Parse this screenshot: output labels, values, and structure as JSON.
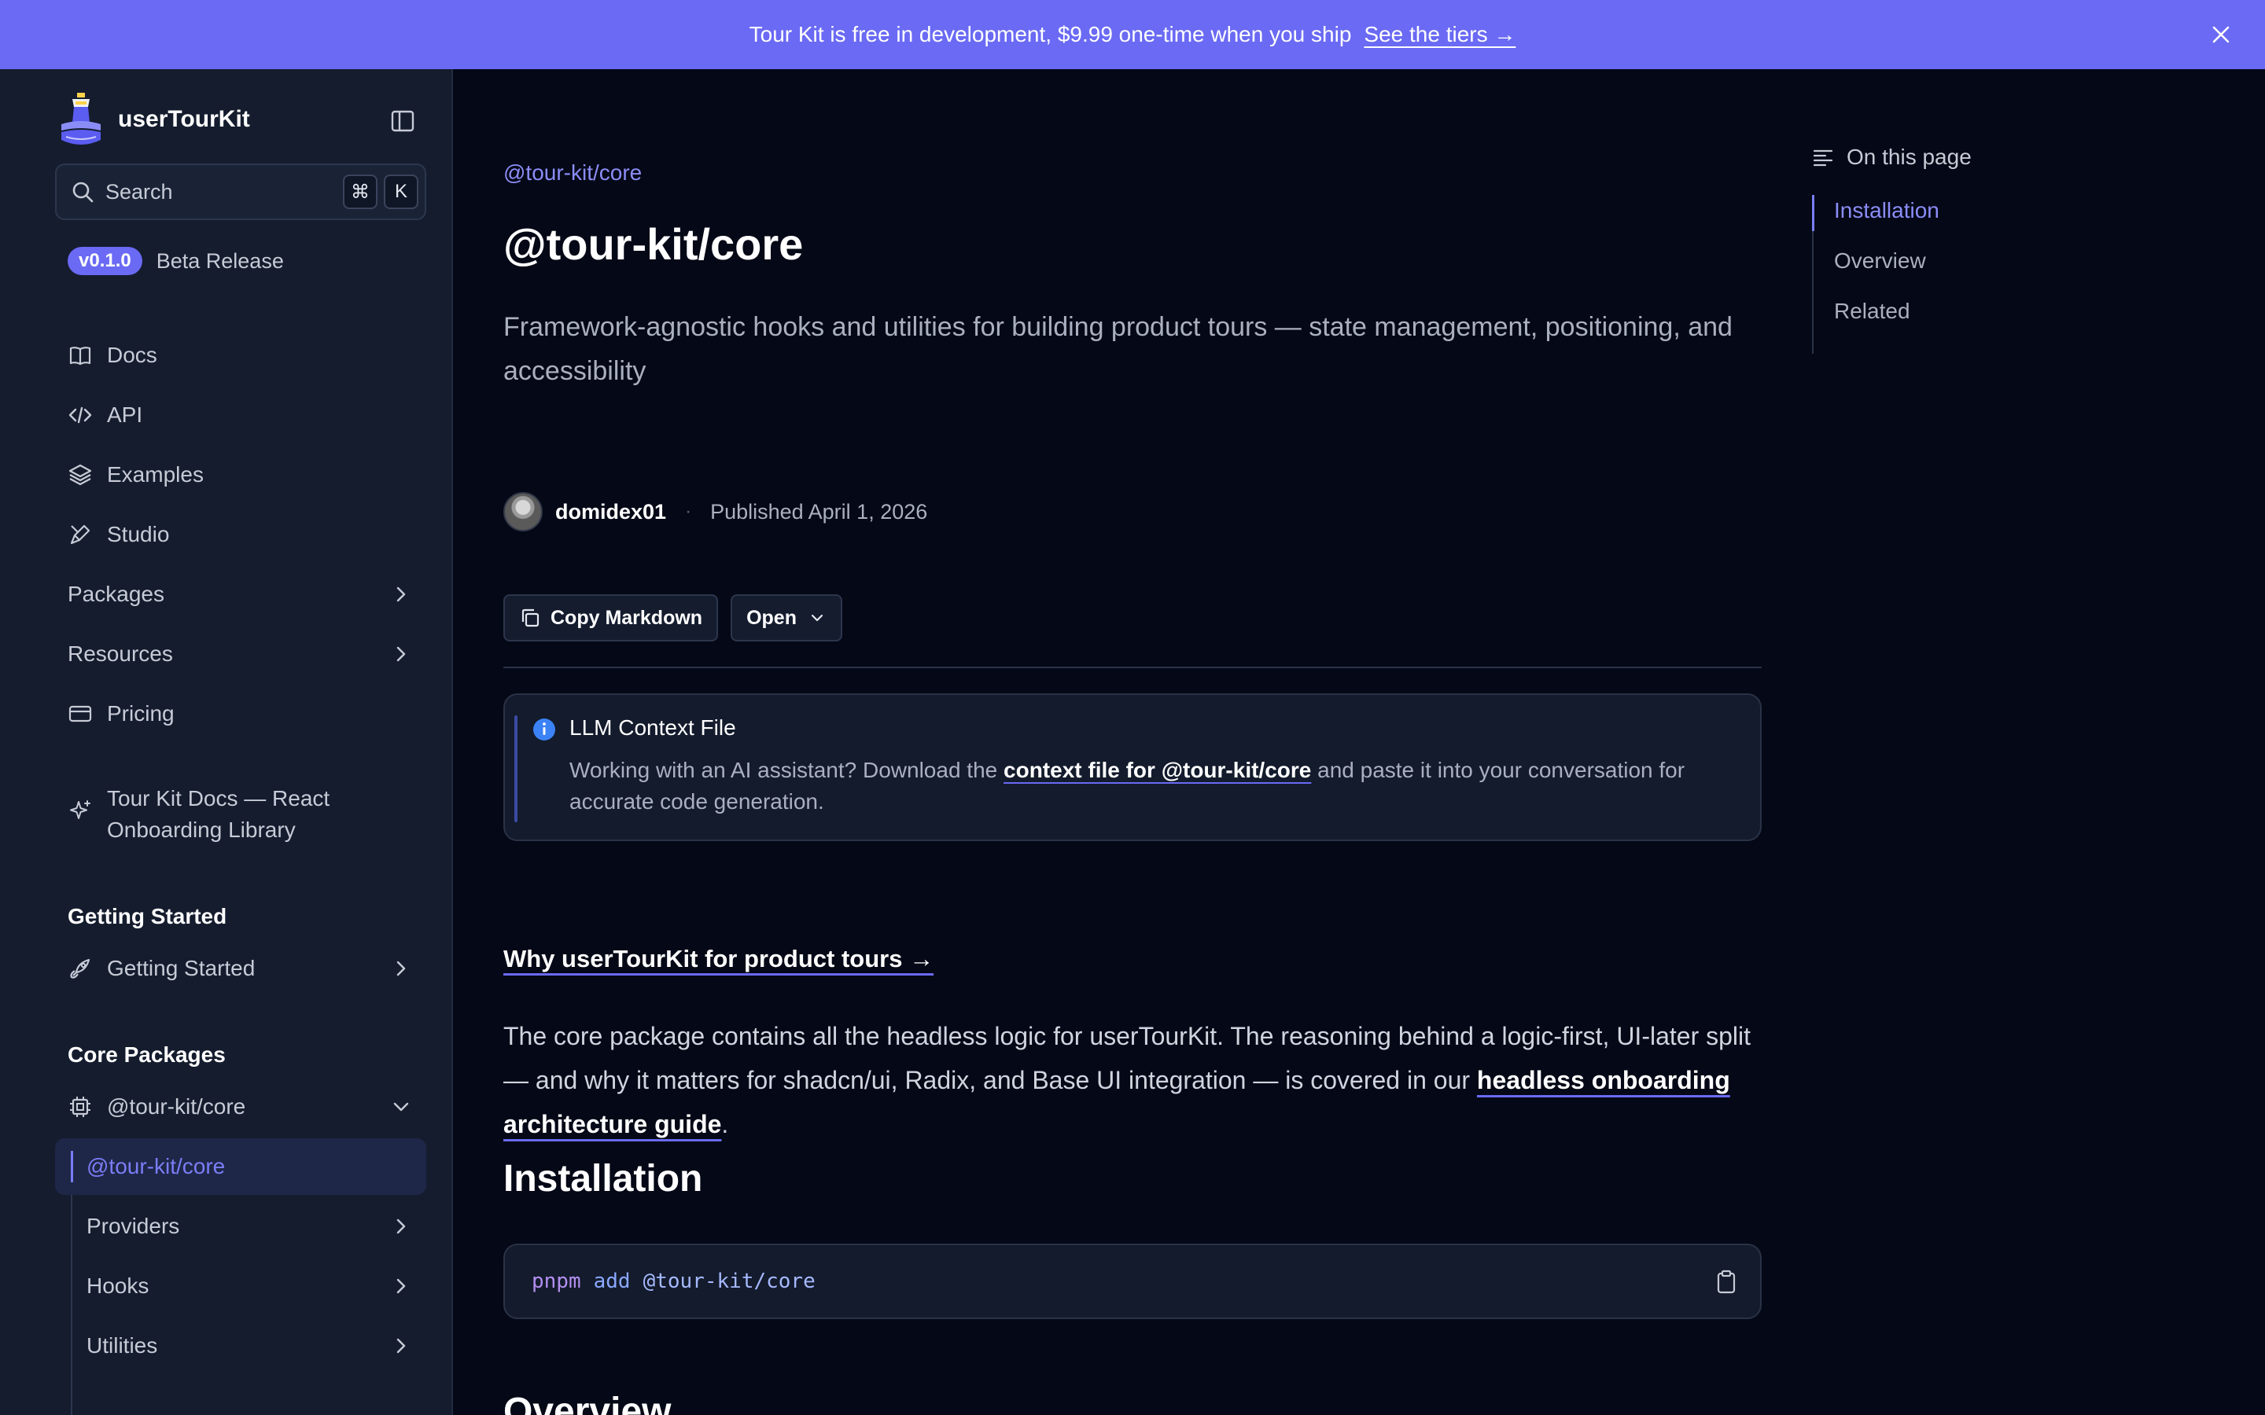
{
  "banner": {
    "message": "Tour Kit is free in development, $9.99 one-time when you ship",
    "cta": "See the tiers →"
  },
  "sidebar": {
    "brand": "userTourKit",
    "search": {
      "placeholder": "Search",
      "shortcut_mod": "⌘",
      "shortcut_key": "K"
    },
    "version": {
      "tag": "v0.1.0",
      "label": "Beta Release"
    },
    "nav": [
      {
        "label": "Docs",
        "icon": "book-icon"
      },
      {
        "label": "API",
        "icon": "code-icon"
      },
      {
        "label": "Examples",
        "icon": "layers-icon"
      },
      {
        "label": "Studio",
        "icon": "pen-tool-icon"
      },
      {
        "label": "Packages",
        "icon": "chevron-right-icon"
      },
      {
        "label": "Resources",
        "icon": "chevron-right-icon"
      },
      {
        "label": "Pricing",
        "icon": "credit-card-icon"
      }
    ],
    "tagline": "Tour Kit Docs — React Onboarding Library",
    "sections": {
      "getting_started": "Getting Started",
      "getting_started_item": "Getting Started",
      "core_packages": "Core Packages",
      "core_item": "@tour-kit/core"
    },
    "core_children": {
      "active": "@tour-kit/core",
      "items": [
        "Providers",
        "Hooks",
        "Utilities"
      ]
    }
  },
  "main": {
    "eyebrow": "@tour-kit/core",
    "title": "@tour-kit/core",
    "description": "Framework-agnostic hooks and utilities for building product tours — state management, positioning, and accessibility",
    "author": {
      "name": "domidex01",
      "separator": "·",
      "published": "Published April 1, 2026"
    },
    "buttons": {
      "copy": "Copy Markdown",
      "open": "Open"
    },
    "callout": {
      "title": "LLM Context File",
      "body_before": "Working with an AI assistant? Download the ",
      "body_link": "context file for @tour-kit/core",
      "body_after": " and paste it into your conversation for accurate code generation."
    },
    "why_link": "Why userTourKit for product tours →",
    "paragraph": {
      "before": "The core package contains all the headless logic for userTourKit. The reasoning behind a logic-first, UI-later split — and why it matters for shadcn/ui, Radix, and Base UI integration — is covered in our ",
      "link": "headless onboarding architecture guide",
      "after": "."
    },
    "installation_heading": "Installation",
    "code": {
      "cmd": "pnpm",
      "sub": "add",
      "pkg": "@tour-kit/core"
    },
    "overview_heading": "Overview"
  },
  "toc": {
    "title": "On this page",
    "items": [
      "Installation",
      "Overview",
      "Related"
    ]
  },
  "colors": {
    "accent": "#6a6af4",
    "background": "#050816",
    "sidebar": "#141c2e",
    "link": "#8b8df7"
  }
}
